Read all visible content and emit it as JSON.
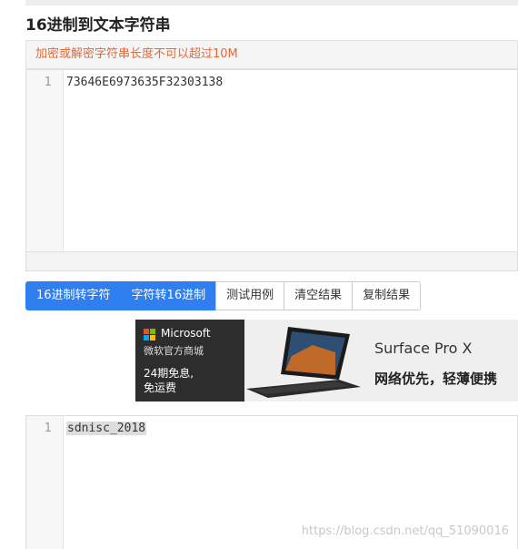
{
  "page_title": "16进制到文本字符串",
  "notice": "加密或解密字符串长度不可以超过10M",
  "input_editor": {
    "line_number": "1",
    "content": "73646E6973635F32303138"
  },
  "buttons": {
    "hex_to_str": "16进制转字符",
    "str_to_hex": "字符转16进制",
    "test_example": "测试用例",
    "clear_result": "清空结果",
    "copy_result": "复制结果"
  },
  "ad": {
    "brand": "Microsoft",
    "store": "微软官方商城",
    "promo_line1": "24期免息,",
    "promo_line2": "免运费",
    "product": "Surface Pro X",
    "slogan": "网络优先，轻薄便携"
  },
  "output_editor": {
    "line_number": "1",
    "content": "sdnisc_2018"
  },
  "watermark": "https://blog.csdn.net/qq_51090016",
  "colors": {
    "primary": "#2f7ff0",
    "notice_text": "#e06a3c"
  }
}
